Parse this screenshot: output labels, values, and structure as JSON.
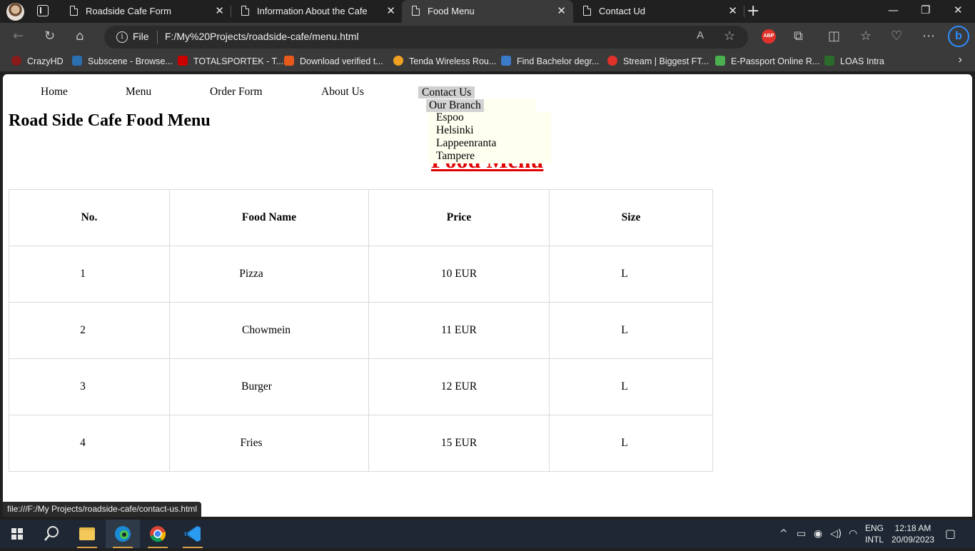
{
  "browser": {
    "tabs": [
      {
        "title": "Roadside Cafe Form",
        "active": false
      },
      {
        "title": "Information About the Cafe",
        "active": false
      },
      {
        "title": "Food Menu",
        "active": true
      },
      {
        "title": "Contact Ud",
        "active": false
      }
    ],
    "address": {
      "scheme_label": "File",
      "url": "F:/My%20Projects/roadside-cafe/menu.html"
    },
    "bookmarks": [
      "CrazyHD",
      "Subscene - Browse...",
      "TOTALSPORTEK - T...",
      "Download verified t...",
      "Tenda Wireless Rou...",
      "Find Bachelor degr...",
      "Stream | Biggest FT...",
      "E-Passport Online R...",
      "LOAS Intra"
    ],
    "status_url": "file:///F:/My Projects/roadside-cafe/contact-us.html",
    "abp_label": "ABP",
    "bing_label": "b"
  },
  "page": {
    "nav": [
      "Home",
      "Menu",
      "Order Form",
      "About Us",
      "Contact Us"
    ],
    "dropdown": {
      "label": "Our Branch",
      "branches": [
        "Espoo",
        "Helsinki",
        "Lappeenranta",
        "Tampere"
      ]
    },
    "title": "Road Side Cafe Food Menu",
    "section_heading": "Food Menu",
    "table": {
      "headers": [
        "No.",
        "Food Name",
        "Price",
        "Size"
      ],
      "rows": [
        [
          "1",
          "Pizza",
          "10 EUR",
          "L"
        ],
        [
          "2",
          "Chowmein",
          "11 EUR",
          "L"
        ],
        [
          "3",
          "Burger",
          "12 EUR",
          "L"
        ],
        [
          "4",
          "Fries",
          "15 EUR",
          "L"
        ]
      ]
    }
  },
  "taskbar": {
    "language": [
      "ENG",
      "INTL"
    ],
    "time": "12:18 AM",
    "date": "20/09/2023"
  }
}
